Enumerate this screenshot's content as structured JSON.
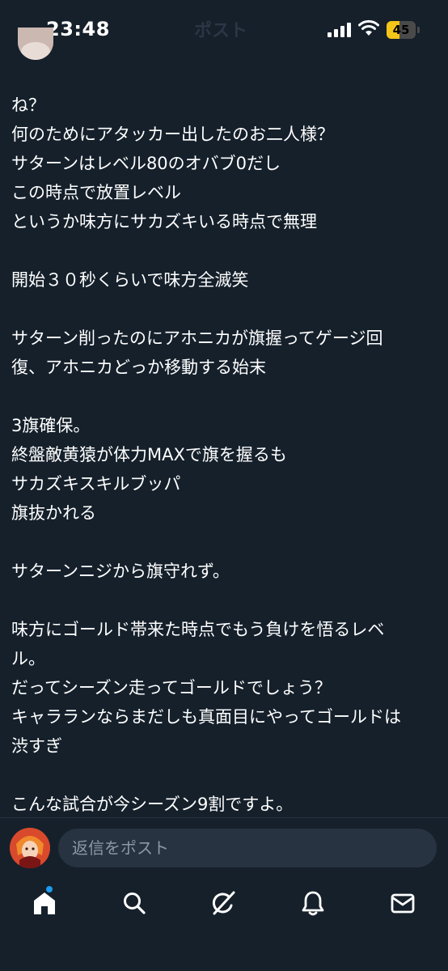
{
  "status_bar": {
    "time": "23:48",
    "battery_percent": "45",
    "battery_level": 0.45
  },
  "header": {
    "title": "ポスト"
  },
  "post": {
    "lines": [
      "ね？",
      "何のためにアタッカー出したのお二人様？",
      "サターンはレベル80のオバブ0だし",
      "この時点で放置レベル",
      "というか味方にサカズキいる時点で無理",
      "",
      "開始３０秒くらいで味方全滅笑",
      "",
      "サターン削ったのにアホニカが旗握ってゲージ回",
      "復、アホニカどっか移動する始末",
      "",
      "3旗確保。",
      "終盤敵黄猿が体力MAXで旗を握るも",
      "サカズキスキルブッパ",
      "旗抜かれる",
      "",
      "サターンニジから旗守れず。",
      "",
      "味方にゴールド帯来た時点でもう負けを悟るレベ",
      "ル。",
      "だってシーズン走ってゴールドでしょう？",
      "キャラランならまだしも真面目にやってゴールドは",
      "渋すぎ",
      "",
      "こんな試合が今シーズン9割ですよ。"
    ]
  },
  "reply": {
    "placeholder": "返信をポスト"
  },
  "tabs": [
    {
      "icon": "home-icon",
      "active": true,
      "has_notification_dot": true
    },
    {
      "icon": "search-icon",
      "active": false
    },
    {
      "icon": "grok-icon",
      "active": false
    },
    {
      "icon": "bell-icon",
      "active": false
    },
    {
      "icon": "mail-icon",
      "active": false
    }
  ],
  "colors": {
    "background": "#15202b",
    "text": "#ffffff",
    "muted": "#8b98a5",
    "accent": "#1d9bf0",
    "battery": "#f5c518"
  }
}
